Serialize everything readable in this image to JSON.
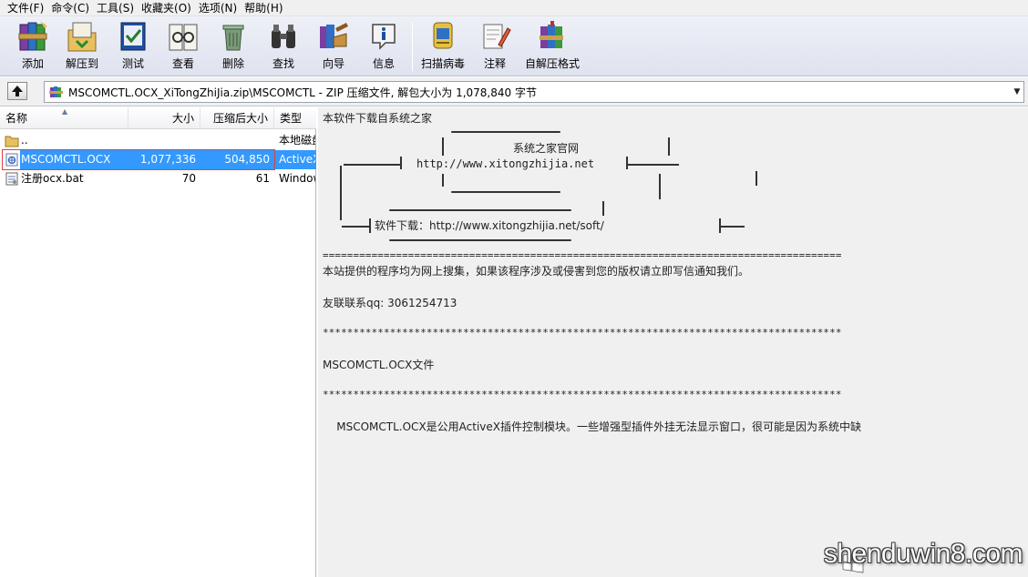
{
  "menu": [
    "文件(F)",
    "命令(C)",
    "工具(S)",
    "收藏夹(O)",
    "选项(N)",
    "帮助(H)"
  ],
  "toolbar": {
    "add": "添加",
    "extract_to": "解压到",
    "test": "测试",
    "view": "查看",
    "delete": "删除",
    "find": "查找",
    "wizard": "向导",
    "info": "信息",
    "virus_scan": "扫描病毒",
    "comment": "注释",
    "sfx": "自解压格式"
  },
  "address": {
    "path": "MSCOMCTL.OCX_XiTongZhiJia.zip\\MSCOMCTL - ZIP 压缩文件, 解包大小为 1,078,840 字节"
  },
  "file_list": {
    "headers": {
      "name": "名称",
      "size": "大小",
      "packed": "压缩后大小",
      "type": "类型"
    },
    "rows": [
      {
        "name": "..",
        "size": "",
        "packed": "",
        "type": "本地磁盘",
        "icon": "folder-icon"
      },
      {
        "name": "MSCOMCTL.OCX",
        "size": "1,077,336",
        "packed": "504,850",
        "type": "ActiveX",
        "icon": "activex-file-icon"
      },
      {
        "name": "注册ocx.bat",
        "size": "70",
        "packed": "61",
        "type": "Windows",
        "icon": "batch-file-icon"
      }
    ]
  },
  "viewer": {
    "line1": "本软件下载自系统之家",
    "site_name": "系统之家官网",
    "site_url": "http://www.xitongzhijia.net",
    "soft_label": "软件下载：http://www.xitongzhijia.net/soft/",
    "divider": "=====================================================================================",
    "disclaimer": "本站提供的程序均为网上搜集，如果该程序涉及或侵害到您的版权请立即写信通知我们。",
    "contact": "友联联系qq: 3061254713",
    "stars1": "*************************************************************************************",
    "file_title": "MSCOMCTL.OCX文件",
    "stars2": "*************************************************************************************",
    "description": "    MSCOMCTL.OCX是公用ActiveX插件控制模块。一些增强型插件外挂无法显示窗口，很可能是因为系统中缺"
  },
  "watermark": "shenduwin8.com"
}
